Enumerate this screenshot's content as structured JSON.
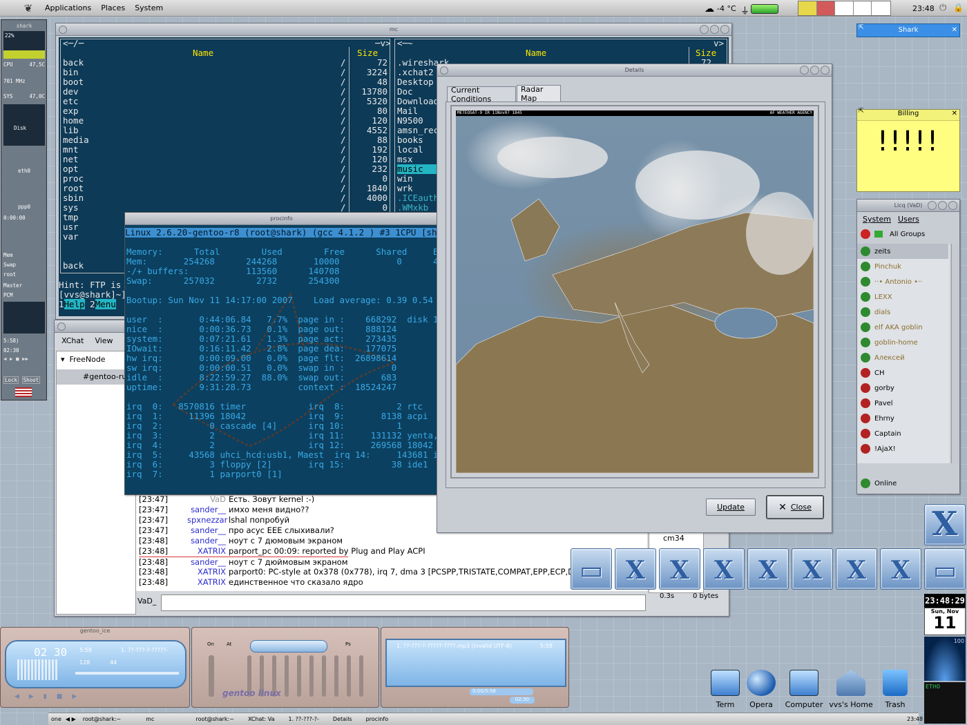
{
  "top_panel": {
    "menus": [
      "Applications",
      "Places",
      "System"
    ],
    "weather": "-4 °C",
    "clock": "23:48"
  },
  "mc": {
    "title": "mc",
    "left_path": "<─/─",
    "left_path_right": "─v>",
    "right_path": "<─~",
    "right_path_right": "v>",
    "col_name": "Name",
    "col_size": "Size",
    "left": [
      [
        "back",
        "72"
      ],
      [
        "bin",
        "3224"
      ],
      [
        "boot",
        "48"
      ],
      [
        "dev",
        "13780"
      ],
      [
        "etc",
        "5320"
      ],
      [
        "exp",
        "80"
      ],
      [
        "home",
        "120"
      ],
      [
        "lib",
        "4552"
      ],
      [
        "media",
        "88"
      ],
      [
        "mnt",
        "192"
      ],
      [
        "net",
        "120"
      ],
      [
        "opt",
        "232"
      ],
      [
        "proc",
        "0"
      ],
      [
        "root",
        "1840"
      ],
      [
        "sbin",
        "4000"
      ],
      [
        "sys",
        "0"
      ],
      [
        "tmp",
        ""
      ],
      [
        "usr",
        ""
      ],
      [
        "var",
        ""
      ]
    ],
    "right": [
      ".wireshark",
      ".xchat2",
      "Desktop",
      "Doc",
      "Download",
      "Mail",
      "N9500",
      "amsn_rece",
      "books",
      "local",
      "msx",
      "music",
      "win",
      "wrk",
      ".ICEautho",
      ".WMxkb"
    ],
    "right_first_size": "72",
    "footer_sel": "back",
    "hint": "Hint: FTP is b",
    "prompt": "[vvs@shark]~]",
    "keys": [
      [
        "1",
        "Help"
      ],
      [
        "2",
        "Menu"
      ]
    ]
  },
  "procinfo": {
    "title": "procinfo",
    "lines": [
      "Linux 2.6.20-gentoo-r8 (root@shark) (gcc 4.1.2 ) #3 1CPU [shark.",
      "",
      "Memory:      Total        Used        Free      Shared     Buffer",
      "Mem:       254268      244268       10000           0      457",
      "-/+ buffers:           113560      140708",
      "Swap:      257032        2732      254300",
      "",
      "Bootup: Sun Nov 11 14:17:00 2007    Load average: 0.39 0.54 0.36",
      "",
      "user  :       0:44:06.84   7.7%  page in :    668292  disk 1:",
      "nice  :       0:00:36.73   0.1%  page out:    888124",
      "system:       0:07:21.61   1.3%  page act:    273435",
      "IOwait:       0:16:11.42   2.8%  page dea:    177075",
      "hw irq:       0:00:09.00   0.0%  page flt:  26898614",
      "sw irq:       0:00:00.51   0.0%  swap in :         0",
      "idle  :       8:22:59.27  88.0%  swap out:       683",
      "uptime:       9:31:28.73         context :  18524247",
      "",
      "irq  0:   8570816 timer            irq  8:          2 rtc",
      "irq  1:     11396 18042            irq  9:       8138 acpi",
      "irq  2:         0 cascade [4]      irq 10:          1",
      "irq  3:         2                  irq 11:     131132 yenta,",
      "irq  4:         2                  irq 12:     269568 18042",
      "irq  5:     43568 uhci_hcd:usb1, Maest  irq 14:     143681 ide0",
      "irq  6:         3 floppy [2]       irq 15:         38 ide1",
      "irq  7:         1 parport0 [1]"
    ]
  },
  "xchat": {
    "menus": [
      "XChat",
      "View",
      "Se"
    ],
    "network": "FreeNode",
    "channel": "#gentoo-ru",
    "input_nick": "VaD_",
    "messages": [
      [
        "[23:47]",
        "VaD",
        "Есть. Зовут kernel :-)"
      ],
      [
        "[23:47]",
        "sander__",
        "имхо меня видно??"
      ],
      [
        "[23:47]",
        "spxnezzar",
        "lshal попробуй"
      ],
      [
        "[23:47]",
        "sander__",
        "про асус EEE слыхивали?"
      ],
      [
        "[23:48]",
        "sander__",
        "ноут с 7 дюмовым экраном"
      ],
      [
        "[23:48]",
        "XATRIX",
        "parport_pc 00:09: reported by Plug and Play ACPI"
      ],
      [
        "[23:48]",
        "sander__",
        "ноут с 7 дюймовым экраном"
      ],
      [
        "[23:48]",
        "XATRIX",
        "parport0: PC-style at 0x378 (0x778), irq 7, dma 3 [PCSPP,TRISTATE,COMPAT,EPP,ECP,DMA"
      ],
      [
        "[23:48]",
        "XATRIX",
        "единственное что сказало ядро"
      ]
    ],
    "userlist_item": "cm34",
    "lag": "0.3s",
    "throughput": "0 bytes"
  },
  "details": {
    "title": "Details",
    "tabs": [
      "Current Conditions",
      "Radar Map"
    ],
    "map_header_left": "METEOSAT-9 IR 11Nov07 1845",
    "map_header_right": "AF WEATHER AGENCY",
    "update_label": "Update",
    "close_label": "Close"
  },
  "shark": {
    "title": "Shark"
  },
  "billing": {
    "title": "Billing",
    "text": "!!!!!"
  },
  "licq": {
    "title": "Licq (VaD)",
    "menus": [
      "System",
      "Users"
    ],
    "group": "All Groups",
    "contacts": [
      [
        "zeits",
        "#2f8a2f"
      ],
      [
        "Pinchuk",
        "#2f8a2f"
      ],
      [
        "··• Antonio •··",
        "#2f8a2f"
      ],
      [
        "LEXX",
        "#2f8a2f"
      ],
      [
        "dials",
        "#2f8a2f"
      ],
      [
        "elf AKA goblin",
        "#2f8a2f"
      ],
      [
        "goblin-home",
        "#2f8a2f"
      ],
      [
        "Алексей",
        "#2f8a2f"
      ],
      [
        "CH",
        "#b22222"
      ],
      [
        "gorby",
        "#b22222"
      ],
      [
        "Pavel",
        "#b22222"
      ],
      [
        "Ehrny",
        "#b22222"
      ],
      [
        "Captain",
        "#b22222"
      ],
      [
        "!AjaX!",
        "#b22222"
      ]
    ],
    "status": "Online"
  },
  "gkrellm": {
    "host": "shark",
    "cpu_pct": "22%",
    "cpu": "CPU",
    "cpu_temp": "47,5C",
    "freq": "701 MHz",
    "sys": "SYS",
    "sys_temp": "47,0C",
    "disk": "Disk",
    "eth0": "eth0",
    "ppp0": "ppp0",
    "ppp_time": "0:00:00",
    "mem": "Mem",
    "swap": "Swap",
    "root": "root",
    "master": "Master",
    "pcm": "PCM",
    "apm": "5:58)",
    "clock": "02:30",
    "lock": "Lock",
    "shoot": "Shoot"
  },
  "xmms": {
    "title": "gentoo_ice",
    "time": "02 30",
    "elapsed": "5:58",
    "kbps": "128",
    "khz": "44",
    "track": "1. ??-???-?-?????-",
    "eq_on": "On",
    "eq_auto": "At",
    "eq_ps": "Ps",
    "logo": "gentoo linux",
    "playlist_item": "1. ??-???-?-?????-????.mp3 (invalid UTF-8)",
    "playlist_time": "5:58",
    "pl_pos": "0:00/5:58",
    "pl_time": "02:30"
  },
  "dock": {
    "clock": "23:48:29",
    "date_day": "Sun, Nov",
    "date_num": "11",
    "eth_label": "ETH0",
    "cpu_load": "100"
  },
  "desktop_icons": [
    "Term",
    "Opera",
    "Computer",
    "vvs's Home",
    "Trash"
  ],
  "taskbar": {
    "items": [
      "one",
      "root@shark:~",
      "mc",
      "root@shark:~",
      "XChat: Va",
      "1. ??-???-?-",
      "Details",
      "procinfo"
    ],
    "clock": "23:48"
  },
  "colors": {
    "terminal_bg": "#0d3a57",
    "term_yellow": "#ffe600",
    "term_cyan": "#23b5c4",
    "procinfo_blue": "#39a9e6",
    "sticky_yellow": "#fffe80"
  }
}
